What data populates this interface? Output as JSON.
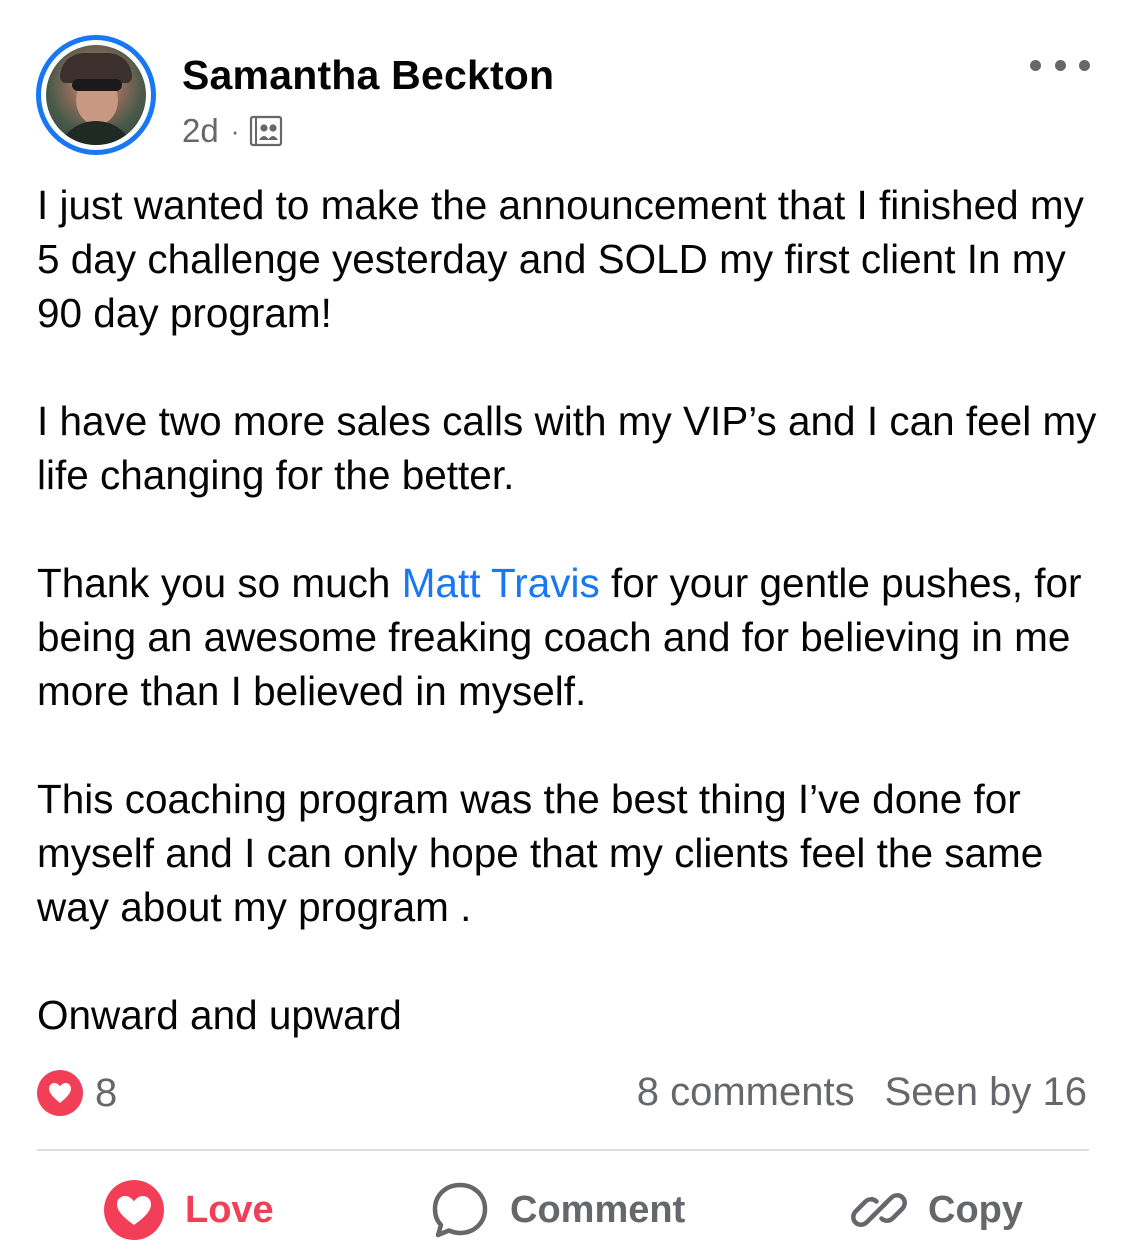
{
  "post": {
    "author": "Samantha Beckton",
    "time": "2d",
    "separator": "·",
    "audience_icon": "group-members-icon",
    "more_icon": "more-options-icon",
    "paragraphs": {
      "p1": "I just wanted to make the announcement that I finished my 5 day challenge yesterday and SOLD my first client In my 90 day program!",
      "p2": "I have two more sales calls with my VIP’s  and I can feel my life changing for the better.",
      "p3_before": "Thank you so much ",
      "p3_mention": "Matt Travis",
      "p3_after": " for your gentle pushes, for being an awesome freaking coach and for believing in me more than I believed in myself.",
      "p4": "This coaching program was the best thing I’ve done for myself and I can only hope that my clients feel the same way about my program .",
      "p5": "Onward and upward"
    }
  },
  "stats": {
    "reaction_count": "8",
    "comments": "8 comments",
    "seen_by": "Seen by 16"
  },
  "actions": {
    "love_label": "Love",
    "comment_label": "Comment",
    "copy_label": "Copy"
  },
  "colors": {
    "accent_blue": "#1877f2",
    "love_red": "#f33e58",
    "secondary_text": "#65676b",
    "divider": "#dadde1"
  }
}
